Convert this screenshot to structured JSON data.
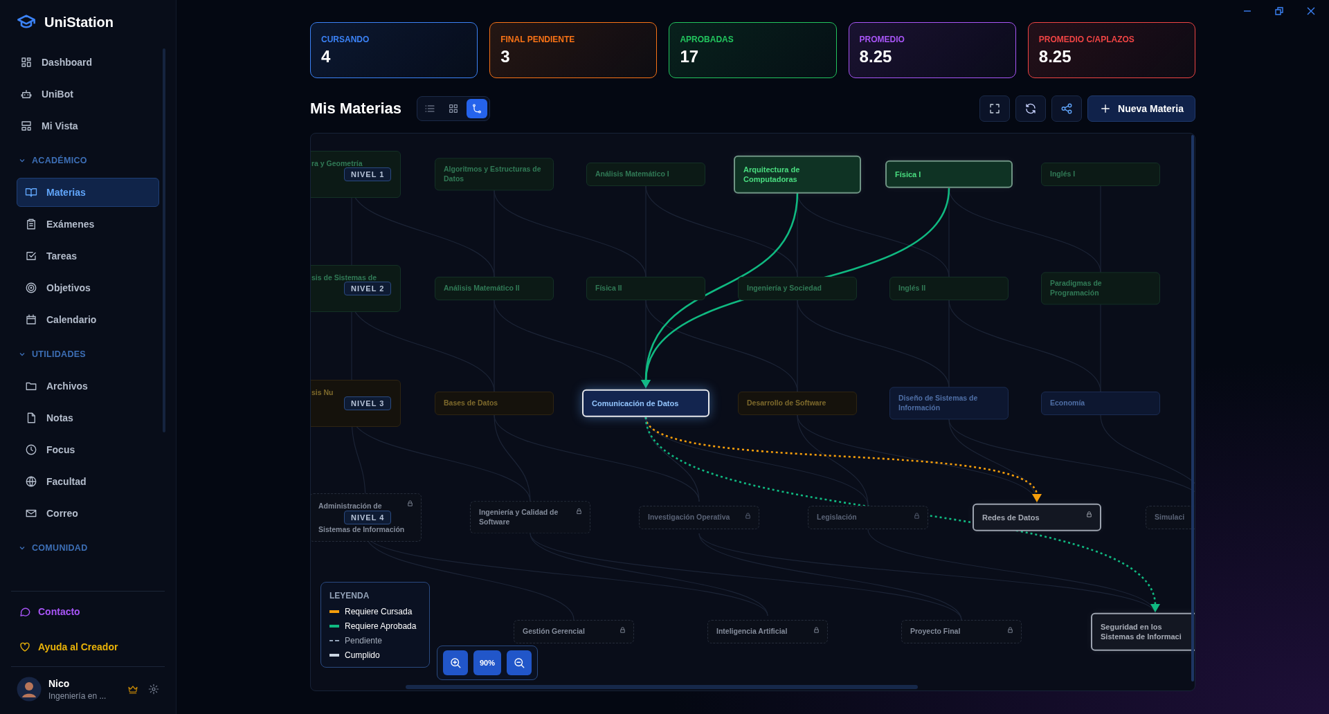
{
  "app": {
    "name": "UniStation"
  },
  "sidebar": {
    "top_items": [
      {
        "label": "Dashboard",
        "selected": false
      },
      {
        "label": "UniBot",
        "selected": false
      },
      {
        "label": "Mi Vista",
        "selected": false
      }
    ],
    "sections": [
      {
        "title": "ACADÉMICO",
        "expanded": true,
        "items": [
          {
            "label": "Materias",
            "selected": true
          },
          {
            "label": "Exámenes",
            "selected": false
          },
          {
            "label": "Tareas",
            "selected": false
          },
          {
            "label": "Objetivos",
            "selected": false
          },
          {
            "label": "Calendario",
            "selected": false
          }
        ]
      },
      {
        "title": "UTILIDADES",
        "expanded": true,
        "items": [
          {
            "label": "Archivos",
            "selected": false
          },
          {
            "label": "Notas",
            "selected": false
          },
          {
            "label": "Focus",
            "selected": false
          },
          {
            "label": "Facultad",
            "selected": false
          },
          {
            "label": "Correo",
            "selected": false
          }
        ]
      },
      {
        "title": "COMUNIDAD",
        "expanded": true
      }
    ],
    "footer_links": [
      {
        "label": "Contacto",
        "color": "#a855f7"
      },
      {
        "label": "Ayuda al Creador",
        "color": "#eab308"
      }
    ],
    "user": {
      "name": "Nico",
      "subtitle": "Ingeniería en ..."
    }
  },
  "stats": [
    {
      "label": "CURSANDO",
      "value": "4",
      "color": "#3b82f6"
    },
    {
      "label": "FINAL PENDIENTE",
      "value": "3",
      "color": "#f97316"
    },
    {
      "label": "APROBADAS",
      "value": "17",
      "color": "#22c55e"
    },
    {
      "label": "PROMEDIO",
      "value": "8.25",
      "color": "#a855f7"
    },
    {
      "label": "PROMEDIO C/APLAZOS",
      "value": "8.25",
      "color": "#ef4444"
    }
  ],
  "header": {
    "title": "Mis Materias",
    "views": [
      {
        "selected": false
      },
      {
        "selected": false
      },
      {
        "selected": true
      }
    ],
    "new_button": "Nueva Materia"
  },
  "graph": {
    "levels": [
      {
        "label": "NIVEL 1",
        "subjects": [
          {
            "label": "ra y Geometría",
            "kind": "aprobada",
            "selected": false,
            "related": false,
            "faded": true
          },
          {
            "label": "Algoritmos y Estructuras de Datos",
            "kind": "aprobada",
            "selected": false,
            "related": false,
            "faded": true
          },
          {
            "label": "Análisis Matemático I",
            "kind": "aprobada",
            "selected": false,
            "related": false,
            "faded": true
          },
          {
            "label": "Arquitectura de Computadoras",
            "kind": "aprobada",
            "selected": false,
            "related": true,
            "faded": false
          },
          {
            "label": "Física I",
            "kind": "aprobada",
            "selected": false,
            "related": true,
            "faded": false
          },
          {
            "label": "Inglés I",
            "kind": "aprobada",
            "selected": false,
            "related": false,
            "faded": true
          }
        ]
      },
      {
        "label": "NIVEL 2",
        "subjects": [
          {
            "label": "sis de Sistemas de",
            "kind": "aprobada",
            "selected": false,
            "related": false,
            "faded": true
          },
          {
            "label": "Análisis Matemático II",
            "kind": "aprobada",
            "selected": false,
            "related": false,
            "faded": true
          },
          {
            "label": "Física II",
            "kind": "aprobada",
            "selected": false,
            "related": false,
            "faded": true
          },
          {
            "label": "Ingeniería y Sociedad",
            "kind": "aprobada",
            "selected": false,
            "related": false,
            "faded": true
          },
          {
            "label": "Inglés II",
            "kind": "aprobada",
            "selected": false,
            "related": false,
            "faded": true
          },
          {
            "label": "Paradigmas de Programación",
            "kind": "aprobada",
            "selected": false,
            "related": false,
            "faded": true
          }
        ]
      },
      {
        "label": "NIVEL 3",
        "subjects": [
          {
            "label": "sis Nu",
            "kind": "final",
            "selected": false,
            "related": false,
            "faded": true
          },
          {
            "label": "Bases de Datos",
            "kind": "final",
            "selected": false,
            "related": false,
            "faded": true
          },
          {
            "label": "Comunicación de Datos",
            "kind": "cursando",
            "selected": true,
            "related": false,
            "faded": false
          },
          {
            "label": "Desarrollo de Software",
            "kind": "final",
            "selected": false,
            "related": false,
            "faded": true
          },
          {
            "label": "Diseño de Sistemas de Información",
            "kind": "cursando",
            "selected": false,
            "related": false,
            "faded": true
          },
          {
            "label": "Economía",
            "kind": "cursando",
            "selected": false,
            "related": false,
            "faded": true
          }
        ]
      },
      {
        "label": "NIVEL 4",
        "subjects": [
          {
            "label": "Administración de Sistemas de Información",
            "kind": "bloqueada",
            "selected": false,
            "related": false,
            "faded": false
          },
          {
            "label": "Ingeniería y Calidad de Software",
            "kind": "bloqueada",
            "selected": false,
            "related": false,
            "faded": false
          },
          {
            "label": "Investigación Operativa",
            "kind": "bloqueada",
            "selected": false,
            "related": false,
            "faded": true
          },
          {
            "label": "Legislación",
            "kind": "bloqueada",
            "selected": false,
            "related": false,
            "faded": true
          },
          {
            "label": "Redes de Datos",
            "kind": "bloqueada",
            "selected": false,
            "related": true,
            "faded": false
          },
          {
            "label": "Simulaci",
            "kind": "bloqueada",
            "selected": false,
            "related": false,
            "faded": true
          }
        ]
      },
      {
        "subjects": [
          {
            "label": "Gestión Gerencial",
            "kind": "bloqueada",
            "selected": false,
            "related": false,
            "faded": false
          },
          {
            "label": "Inteligencia Artificial",
            "kind": "bloqueada",
            "selected": false,
            "related": false,
            "faded": false
          },
          {
            "label": "Proyecto Final",
            "kind": "bloqueada",
            "selected": false,
            "related": false,
            "faded": false
          },
          {
            "label": "Seguridad en los Sistemas de Informaci",
            "kind": "bloqueada",
            "selected": false,
            "related": true,
            "faded": false
          }
        ]
      }
    ],
    "edges": [
      {
        "kind": "aprobada",
        "done": true
      },
      {
        "kind": "aprobada",
        "done": true
      },
      {
        "kind": "cursada",
        "done": false
      },
      {
        "kind": "aprobada",
        "done": false
      }
    ],
    "legend": {
      "title": "LEYENDA",
      "items": [
        {
          "label": "Requiere Cursada",
          "kind": "solid",
          "color": "#f59e0b"
        },
        {
          "label": "Requiere Aprobada",
          "kind": "solid",
          "color": "#10b981"
        },
        {
          "label": "Pendiente",
          "kind": "dashed",
          "color": "#94a3b8"
        },
        {
          "label": "Cumplido",
          "kind": "solid",
          "color": "#cbd5e1"
        }
      ]
    },
    "zoom": {
      "label": "90%"
    }
  }
}
